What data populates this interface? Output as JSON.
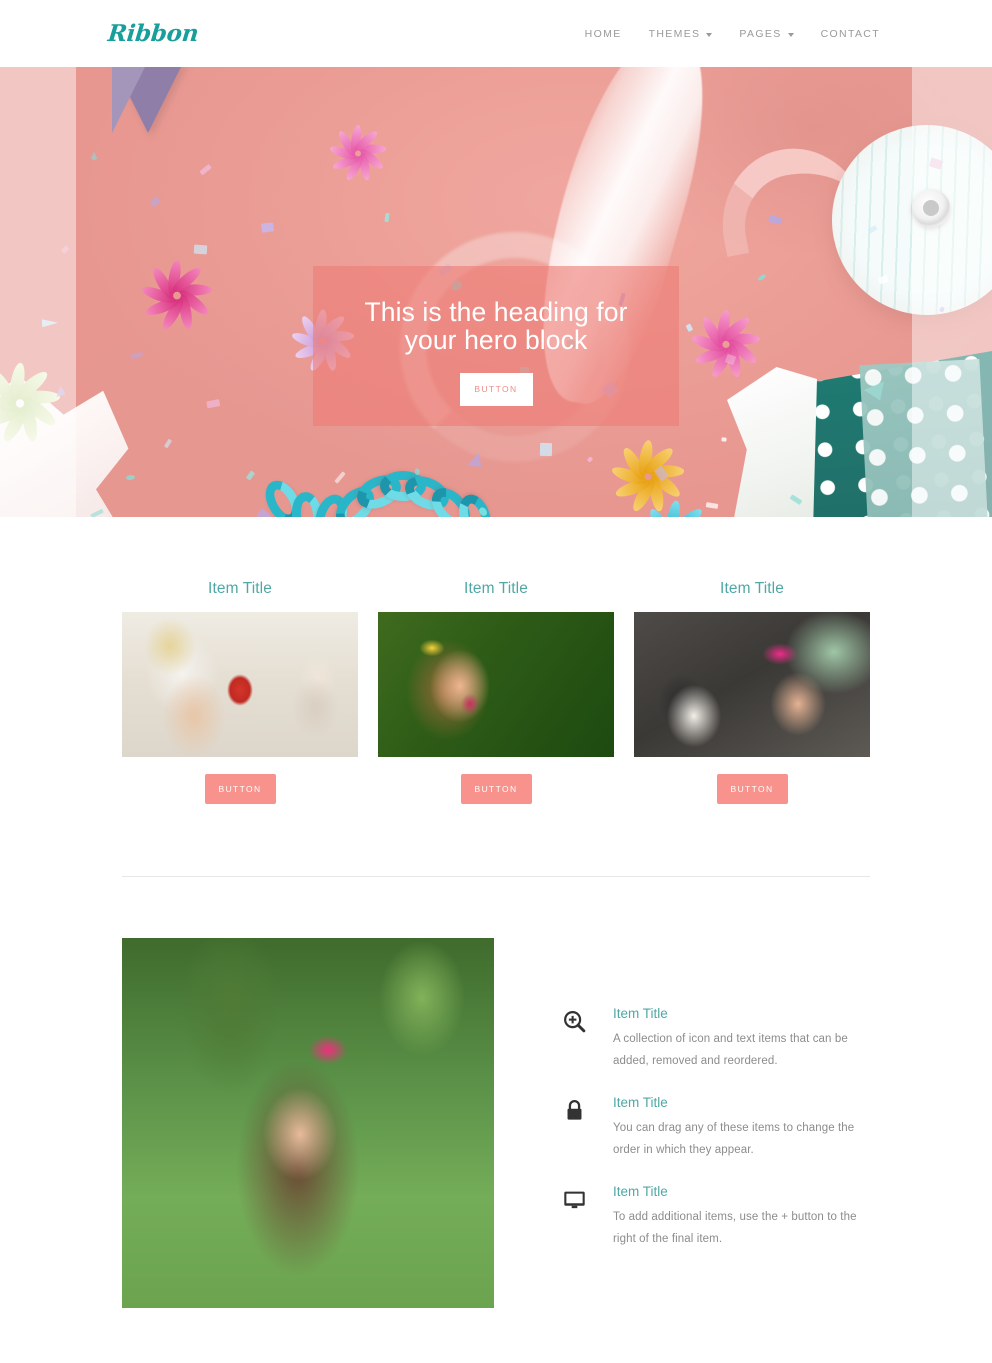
{
  "header": {
    "brand": "Ribbon",
    "nav": [
      {
        "label": "HOME",
        "caret": false
      },
      {
        "label": "THEMES",
        "caret": true
      },
      {
        "label": "PAGES",
        "caret": true
      },
      {
        "label": "CONTACT",
        "caret": false
      }
    ]
  },
  "hero": {
    "heading": "This is the heading for your hero block",
    "button_label": "BUTTON",
    "overlay_color": "#ee7c76",
    "photo_alt": "Pink paper background with confetti, ribbons, gift bows, a ribbon spool and a teal polka-dot gift bag"
  },
  "cards": [
    {
      "title": "Item Title",
      "button_label": "BUTTON",
      "photo_alt": "Woman in white dress seated at a cafe holding a red drink next to a small dog on a chair"
    },
    {
      "title": "Item Title",
      "button_label": "BUTTON",
      "photo_alt": "Smiling toddler girl with a yellow hair bow and colorful face paint on a green background"
    },
    {
      "title": "Item Title",
      "button_label": "BUTTON",
      "photo_alt": "Girl with a pink bow headband sleeping on a couch beside a black and white dog"
    }
  ],
  "features": {
    "photo_alt": "Young girl with a pink bow headband holding a small white flower in a sunny green park",
    "items": [
      {
        "icon": "zoom-in-icon",
        "title": "Item Title",
        "text": "A collection of icon and text items that can be added, removed and reordered."
      },
      {
        "icon": "lock-icon",
        "title": "Item Title",
        "text": "You can drag any of these items to change the order in which they appear."
      },
      {
        "icon": "monitor-icon",
        "title": "Item Title",
        "text": "To add additional items, use the + button to the right of the final item."
      }
    ]
  },
  "colors": {
    "brand_teal": "#189e9b",
    "heading_teal": "#4fa8a4",
    "salmon": "#f8928d",
    "nav_gray": "#9a9a9a",
    "body_gray": "#8c8c8c"
  }
}
